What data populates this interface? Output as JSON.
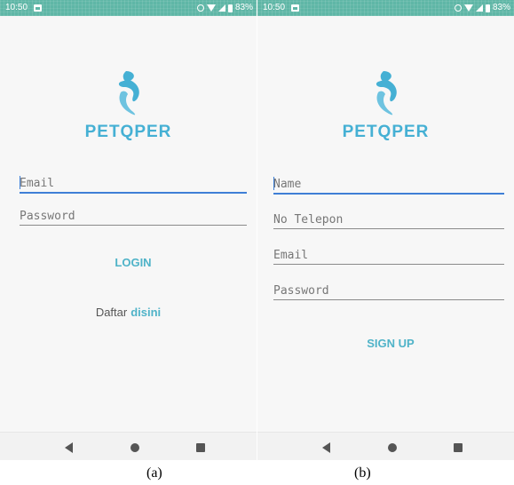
{
  "screens": {
    "login": {
      "status": {
        "time": "10:50",
        "battery_pct": "83%"
      },
      "brand": "PETQPER",
      "email_placeholder": "Email",
      "password_placeholder": "Password",
      "login_label": "LOGIN",
      "register_prefix": "Daftar",
      "register_link": "disini",
      "caption": "(a)"
    },
    "signup": {
      "status": {
        "time": "10:50",
        "battery_pct": "83%"
      },
      "brand": "PETQPER",
      "name_placeholder": "Name",
      "phone_placeholder": "No Telepon",
      "email_placeholder": "Email",
      "password_placeholder": "Password",
      "signup_label": "SIGN UP",
      "caption": "(b)"
    }
  },
  "colors": {
    "status_bar": "#5fb6a6",
    "brand": "#45b0d4",
    "accent_button": "#4fb3c8",
    "focus_underline": "#3f7fd6"
  },
  "icons": {
    "logo": "pet-bird-logo-icon",
    "nav": [
      "back-icon",
      "home-icon",
      "recents-icon"
    ]
  }
}
